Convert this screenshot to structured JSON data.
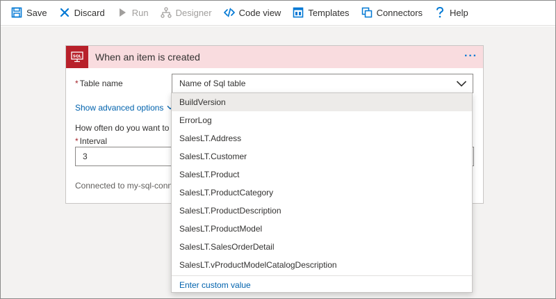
{
  "toolbar": {
    "save": "Save",
    "discard": "Discard",
    "run": "Run",
    "designer": "Designer",
    "code_view": "Code view",
    "templates": "Templates",
    "connectors": "Connectors",
    "help": "Help"
  },
  "trigger_card": {
    "title": "When an item is created",
    "menu": "···",
    "icon": "sql-icon",
    "table_name": {
      "required_mark": "*",
      "label": "Table name",
      "value": "Name of Sql table"
    },
    "advanced_link": "Show advanced options",
    "frequency_question": "How often do you want to",
    "interval": {
      "required_mark": "*",
      "label": "Interval",
      "value": "3"
    },
    "connection": "Connected to my-sql-conn"
  },
  "dropdown": {
    "options": [
      "BuildVersion",
      "ErrorLog",
      "SalesLT.Address",
      "SalesLT.Customer",
      "SalesLT.Product",
      "SalesLT.ProductCategory",
      "SalesLT.ProductDescription",
      "SalesLT.ProductModel",
      "SalesLT.SalesOrderDetail",
      "SalesLT.vProductModelCatalogDescription"
    ],
    "highlighted": "BuildVersion",
    "custom_value": "Enter custom value"
  },
  "colors": {
    "accent": "#0078d4",
    "link": "#0062ad",
    "header_bg": "#f9dcdf",
    "sql_icon_bg": "#b8202a",
    "canvas_bg": "#f3f2f1"
  }
}
